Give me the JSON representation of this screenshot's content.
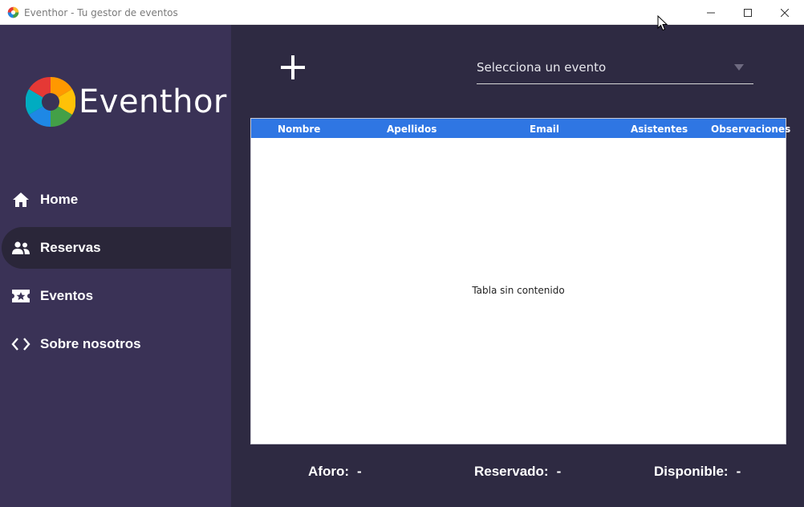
{
  "window": {
    "title": "Eventhor - Tu gestor de eventos"
  },
  "sidebar": {
    "brand": "Eventhor",
    "items": [
      {
        "label": "Home",
        "icon": "home-icon"
      },
      {
        "label": "Reservas",
        "icon": "people-icon",
        "active": true
      },
      {
        "label": "Eventos",
        "icon": "ticket-icon"
      },
      {
        "label": "Sobre nosotros",
        "icon": "code-icon"
      }
    ]
  },
  "main": {
    "add_icon": "plus-icon",
    "event_select": {
      "placeholder": "Selecciona un evento",
      "icon": "dropdown-arrow-icon"
    },
    "table": {
      "columns": [
        "Nombre",
        "Apellidos",
        "Email",
        "Asistentes",
        "Observaciones"
      ],
      "rows": [],
      "empty_text": "Tabla sin contenido"
    },
    "stats": {
      "aforo_label": "Aforo:",
      "aforo_value": "-",
      "reservado_label": "Reservado:",
      "reservado_value": "-",
      "disponible_label": "Disponible:",
      "disponible_value": "-"
    }
  },
  "colors": {
    "sidebar": "#3a3256",
    "main_bg": "#2e2a42",
    "active_item": "#2a2639",
    "table_header": "#2f76e3"
  }
}
